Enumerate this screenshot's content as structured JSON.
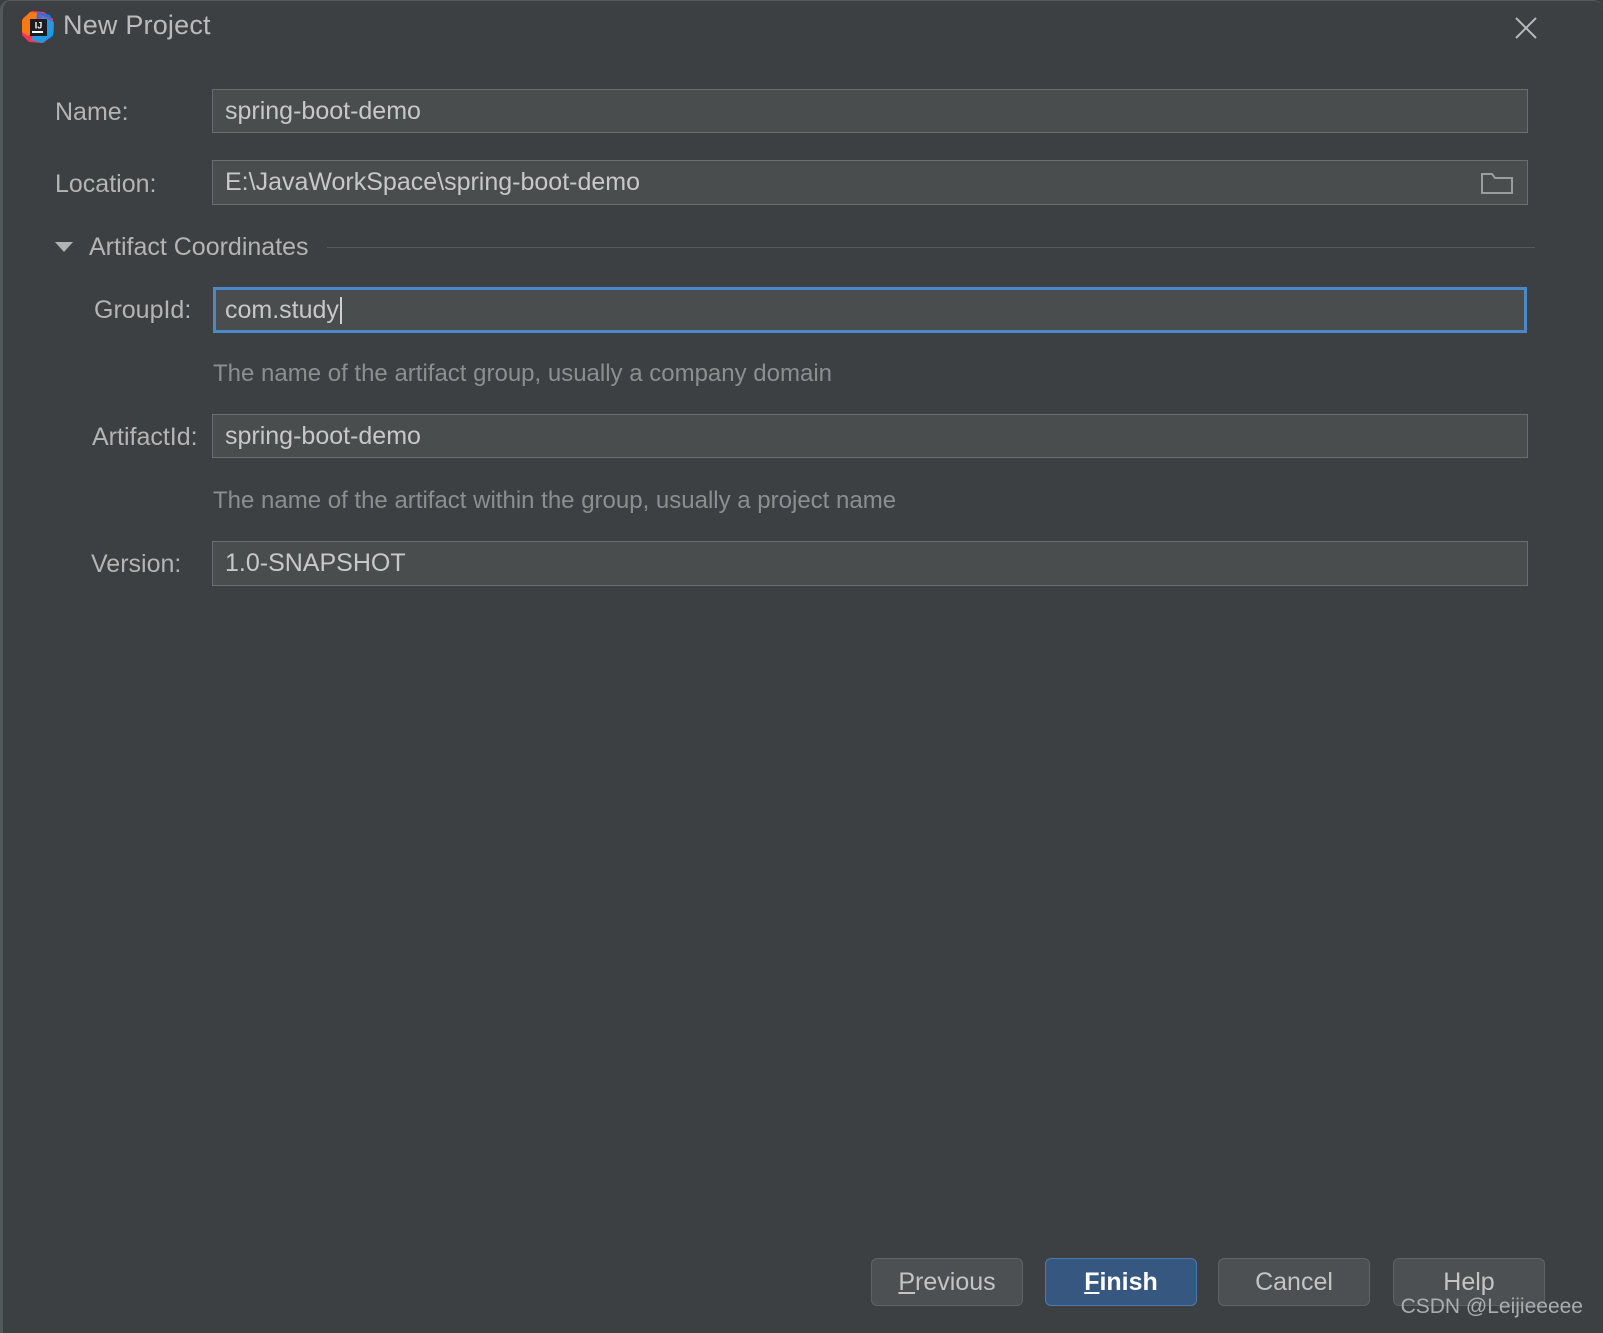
{
  "window": {
    "title": "New Project",
    "app_icon": "intellij-idea-icon",
    "close_icon": "close-icon"
  },
  "form": {
    "name": {
      "label": "Name:",
      "value": "spring-boot-demo"
    },
    "location": {
      "label": "Location:",
      "value": "E:\\JavaWorkSpace\\spring-boot-demo",
      "browse_icon": "folder-icon"
    },
    "artifact_section": {
      "title": "Artifact Coordinates",
      "expanded": true,
      "triangle_icon": "chevron-down-icon"
    },
    "group_id": {
      "label": "GroupId:",
      "value": "com.study",
      "hint": "The name of the artifact group, usually a company domain",
      "focused": true
    },
    "artifact_id": {
      "label": "ArtifactId:",
      "value": "spring-boot-demo",
      "hint": "The name of the artifact within the group, usually a project name"
    },
    "version": {
      "label": "Version:",
      "value": "1.0-SNAPSHOT"
    }
  },
  "buttons": {
    "previous": {
      "prefix": "",
      "mnemonic": "P",
      "suffix": "revious"
    },
    "finish": {
      "prefix": "",
      "mnemonic": "F",
      "suffix": "inish"
    },
    "cancel": {
      "label": "Cancel"
    },
    "help": {
      "label": "Help"
    }
  },
  "watermark": "CSDN @Leijieeeee",
  "colors": {
    "dialog_bg": "#3c4042",
    "field_bg": "#494d4e",
    "field_border": "#6a6e70",
    "focus_ring": "#4a88c7",
    "primary_button": "#365880",
    "text": "#b4b4b4",
    "hint_text": "#8b8f90"
  }
}
